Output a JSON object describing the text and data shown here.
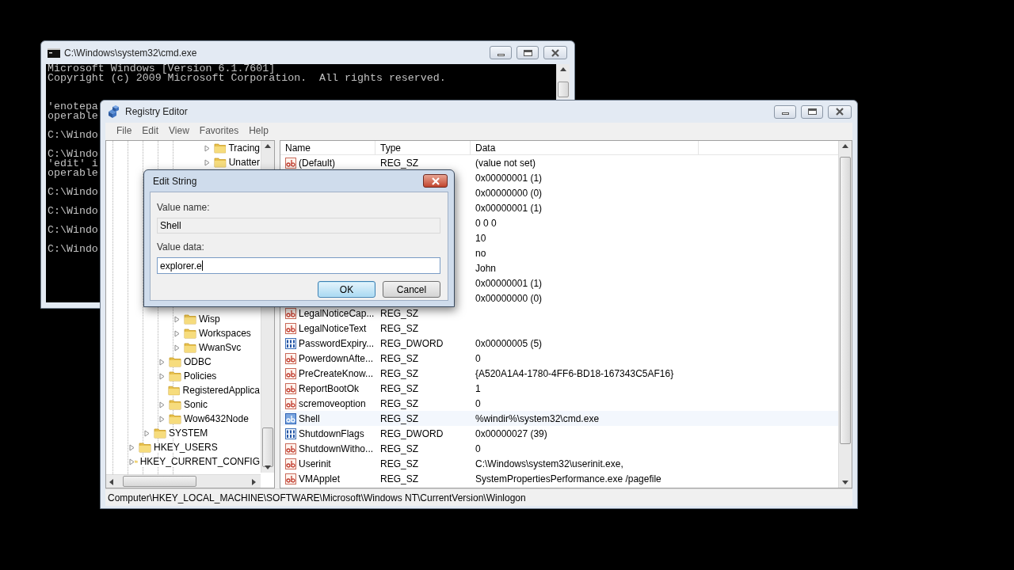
{
  "cmd_window": {
    "title": "C:\\Windows\\system32\\cmd.exe",
    "blocks": [
      {
        "lines": [
          "Microsoft Windows [Version 6.1.7601]",
          "Copyright (c) 2009 Microsoft Corporation.  All rights reserved."
        ],
        "covered_line_above": false
      },
      {
        "lines": [
          "'enotepa",
          "operable"
        ],
        "covered_line_above": true
      },
      {
        "lines": [
          "C:\\Windo"
        ],
        "covered_line_above": false
      },
      {
        "lines": [
          "C:\\Windo",
          "'edit' i",
          "operable"
        ],
        "covered_line_above": false
      },
      {
        "lines": [
          "C:\\Windo"
        ],
        "covered_line_above": false
      },
      {
        "lines": [
          "C:\\Windo"
        ],
        "covered_line_above": false
      },
      {
        "lines": [
          "C:\\Windo"
        ],
        "covered_line_above": false
      },
      {
        "lines": [
          "C:\\Windo"
        ],
        "covered_line_above": false
      }
    ]
  },
  "registry_editor": {
    "title": "Registry Editor",
    "menu": [
      "File",
      "Edit",
      "View",
      "Favorites",
      "Help"
    ],
    "tree": [
      {
        "children": [
          {
            "children": [
              {
                "children": [
                  {
                    "children": [
                      {
                        "children": [
                          {
                            "label": "Tracing",
                            "expandable": true
                          },
                          {
                            "label": "Unatter",
                            "expandable": true
                          }
                        ]
                      }
                    ]
                  },
                  {
                    "label": "Wisp",
                    "expandable": true
                  },
                  {
                    "label": "Workspaces",
                    "expandable": true
                  },
                  {
                    "label": "WwanSvc",
                    "expandable": true
                  }
                ]
              },
              {
                "label": "ODBC",
                "expandable": true
              },
              {
                "label": "Policies",
                "expandable": true
              },
              {
                "label": "RegisteredApplica",
                "expandable": false
              },
              {
                "label": "Sonic",
                "expandable": true
              },
              {
                "label": "Wow6432Node",
                "expandable": true
              }
            ]
          },
          {
            "label": "SYSTEM",
            "expandable": true
          }
        ]
      },
      {
        "label": "HKEY_USERS",
        "expandable": true
      },
      {
        "label": "HKEY_CURRENT_CONFIG",
        "expandable": true
      }
    ],
    "columns": [
      "Name",
      "Type",
      "Data"
    ],
    "values": [
      {
        "name": "(Default)",
        "type": "REG_SZ",
        "data": "(value not set)",
        "kind": "string",
        "selected": false
      },
      {
        "data": "0x00000001 (1)",
        "selected": false
      },
      {
        "data": "0x00000000 (0)",
        "selected": false
      },
      {
        "data": "0x00000001 (1)",
        "selected": false
      },
      {
        "data": "0 0 0",
        "selected": false
      },
      {
        "data": "10",
        "selected": false
      },
      {
        "data": "no",
        "selected": false
      },
      {
        "data": "John",
        "selected": false
      },
      {
        "data": "0x00000001 (1)",
        "selected": false
      },
      {
        "data": "0x00000000 (0)",
        "selected": false
      },
      {
        "name": "LegalNoticeCap...",
        "type": "REG_SZ",
        "kind": "string",
        "selected": false
      },
      {
        "name": "LegalNoticeText",
        "type": "REG_SZ",
        "kind": "string",
        "selected": false
      },
      {
        "name": "PasswordExpiry...",
        "type": "REG_DWORD",
        "data": "0x00000005 (5)",
        "kind": "dword",
        "selected": false
      },
      {
        "name": "PowerdownAfte...",
        "type": "REG_SZ",
        "data": "0",
        "kind": "string",
        "selected": false
      },
      {
        "name": "PreCreateKnow...",
        "type": "REG_SZ",
        "data": "{A520A1A4-1780-4FF6-BD18-167343C5AF16}",
        "kind": "string",
        "selected": false
      },
      {
        "name": "ReportBootOk",
        "type": "REG_SZ",
        "data": "1",
        "kind": "string",
        "selected": false
      },
      {
        "name": "scremoveoption",
        "type": "REG_SZ",
        "data": "0",
        "kind": "string",
        "selected": false
      },
      {
        "name": "Shell",
        "type": "REG_SZ",
        "data": "%windir%\\system32\\cmd.exe",
        "kind": "string",
        "selected": true
      },
      {
        "name": "ShutdownFlags",
        "type": "REG_DWORD",
        "data": "0x00000027 (39)",
        "kind": "dword",
        "selected": false
      },
      {
        "name": "ShutdownWitho...",
        "type": "REG_SZ",
        "data": "0",
        "kind": "string",
        "selected": false
      },
      {
        "name": "Userinit",
        "type": "REG_SZ",
        "data": "C:\\Windows\\system32\\userinit.exe,",
        "kind": "string",
        "selected": false
      },
      {
        "name": "VMApplet",
        "type": "REG_SZ",
        "data": "SystemPropertiesPerformance.exe /pagefile",
        "kind": "string",
        "selected": false
      }
    ],
    "status_bar": "Computer\\HKEY_LOCAL_MACHINE\\SOFTWARE\\Microsoft\\Windows NT\\CurrentVersion\\Winlogon"
  },
  "edit_string_dialog": {
    "title": "Edit String",
    "value_name_label": "Value name:",
    "value_name": "Shell",
    "value_data_label": "Value data:",
    "value_data": "explorer.e",
    "buttons": [
      {
        "label": "OK",
        "default": true
      },
      {
        "label": "Cancel",
        "default": false
      }
    ]
  }
}
